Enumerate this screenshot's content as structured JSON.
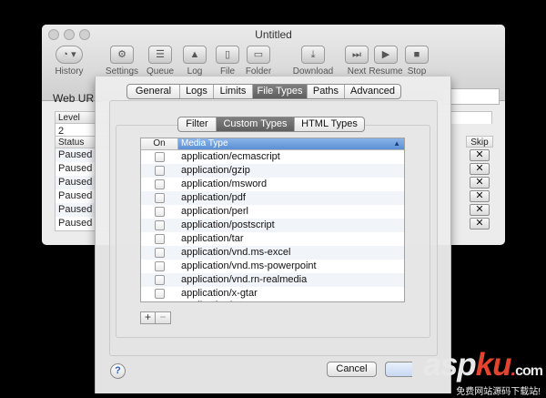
{
  "window": {
    "title": "Untitled",
    "toolbar": [
      {
        "name": "history",
        "label": "History",
        "icon": "clock-icon",
        "glyph": "◔ ▾"
      },
      {
        "name": "settings",
        "label": "Settings",
        "icon": "gear-icon",
        "glyph": "⚙"
      },
      {
        "name": "queue",
        "label": "Queue",
        "icon": "list-icon",
        "glyph": "☰"
      },
      {
        "name": "log",
        "label": "Log",
        "icon": "warning-icon",
        "glyph": "▲"
      },
      {
        "name": "file",
        "label": "File",
        "icon": "document-icon",
        "glyph": "▯"
      },
      {
        "name": "folder",
        "label": "Folder",
        "icon": "folder-icon",
        "glyph": "▭"
      },
      {
        "name": "download",
        "label": "Download",
        "icon": "download-icon",
        "glyph": "⤓"
      },
      {
        "name": "next",
        "label": "Next",
        "icon": "skip-forward-icon",
        "glyph": "⏭"
      },
      {
        "name": "resume",
        "label": "Resume",
        "icon": "play-icon",
        "glyph": "▶"
      },
      {
        "name": "stop",
        "label": "Stop",
        "icon": "stop-icon",
        "glyph": "■"
      }
    ],
    "url_label": "Web URL:",
    "level_header": "Level",
    "level_value": "2",
    "status_header": "Status",
    "statuses": [
      "Paused",
      "Paused",
      "Paused",
      "Paused",
      "Paused",
      "Paused"
    ],
    "skip_header": "Skip",
    "skip_glyph": "✕"
  },
  "sheet": {
    "tabs": [
      "General",
      "Logs",
      "Limits",
      "File Types",
      "Paths",
      "Advanced"
    ],
    "active_tab": "File Types",
    "sub_tabs": [
      "Filter",
      "Custom Types",
      "HTML Types"
    ],
    "active_sub_tab": "Custom Types",
    "table": {
      "col_on": "On",
      "col_type": "Media Type",
      "sort_indicator": "▲",
      "rows": [
        "application/ecmascript",
        "application/gzip",
        "application/msword",
        "application/pdf",
        "application/perl",
        "application/postscript",
        "application/tar",
        "application/vnd.ms-excel",
        "application/vnd.ms-powerpoint",
        "application/vnd.rn-realmedia",
        "application/x-gtar"
      ]
    },
    "add_label": "+",
    "remove_label": "−",
    "help_label": "?",
    "cancel_label": "Cancel"
  },
  "watermark": {
    "logo_asp": "asp",
    "logo_ku": "ku",
    "logo_com": "com",
    "subtitle": "免费网站源码下载站!"
  }
}
